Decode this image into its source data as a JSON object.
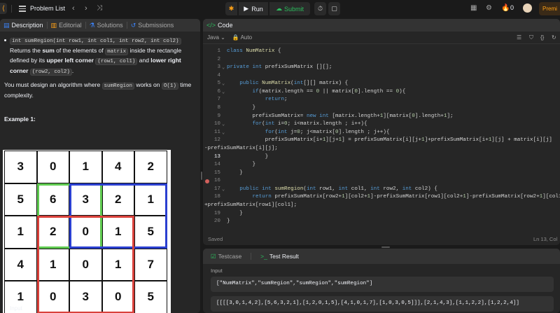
{
  "topbar": {
    "problem_list": "Problem List",
    "run": "Run",
    "submit": "Submit",
    "notif_count": "0",
    "premium": "Premi"
  },
  "left_tabs": [
    "Description",
    "Editorial",
    "Solutions",
    "Submissions"
  ],
  "description": {
    "signature": "int sumRegion(int row1, int col1, int row2, int col2)",
    "l1a": " Returns the ",
    "l1b": "sum",
    "l1c": " of the elements of ",
    "matrix_word": "matrix",
    "l1d": " inside the rectangle defined by its ",
    "upper_left": "upper left corner",
    "ul_coord": "(row1, col1)",
    "and": " and ",
    "lower_right": "lower right corner",
    "lr_coord": "(row2, col2)",
    "period": ".",
    "must_a": "You must design an algorithm where ",
    "sumregion_word": "sumRegion",
    "must_b": " works on ",
    "o1": "O(1)",
    "must_c": " time complexity.",
    "example": "Example 1:"
  },
  "grid": [
    [
      "3",
      "0",
      "1",
      "4",
      "2"
    ],
    [
      "5",
      "6",
      "3",
      "2",
      "1"
    ],
    [
      "1",
      "2",
      "0",
      "1",
      "5"
    ],
    [
      "4",
      "1",
      "0",
      "1",
      "7"
    ],
    [
      "1",
      "0",
      "3",
      "0",
      "5"
    ]
  ],
  "input_peek": "Input",
  "code_tab": "Code",
  "language": "Java",
  "auto": "Auto",
  "code_lines": [
    {
      "n": "1",
      "t": "class NumMatrix {"
    },
    {
      "n": "2",
      "t": ""
    },
    {
      "n": "3",
      "t": "private int prefixSumMatrix [][];"
    },
    {
      "n": "4",
      "t": ""
    },
    {
      "n": "5",
      "t": "    public NumMatrix(int[][] matrix) {"
    },
    {
      "n": "6",
      "t": "        if(matrix.length == 0 || matrix[0].length == 0){"
    },
    {
      "n": "7",
      "t": "            return;"
    },
    {
      "n": "8",
      "t": "        }"
    },
    {
      "n": "9",
      "t": "        prefixSumMatrix= new int [matrix.length+1][matrix[0].length+1];"
    },
    {
      "n": "10",
      "t": "        for(int i=0; i<matrix.length ; i++){"
    },
    {
      "n": "11",
      "t": "            for(int j=0; j<matrix[0].length ; j++){"
    },
    {
      "n": "12",
      "t": "            prefixSumMatrix[i+1][j+1] = prefixSumMatrix[i][j+1]+prefixSumMatrix[i+1][j] + matrix[i][j]"
    },
    {
      "n": "",
      "t": "-prefixSumMatrix[i][j];"
    },
    {
      "n": "13",
      "t": "            }"
    },
    {
      "n": "14",
      "t": "        }"
    },
    {
      "n": "15",
      "t": "    }"
    },
    {
      "n": "16",
      "t": ""
    },
    {
      "n": "17",
      "t": "    public int sumRegion(int row1, int col1, int row2, int col2) {"
    },
    {
      "n": "18",
      "t": "        return prefixSumMatrix[row2+1][col2+1]-prefixSumMatrix[row1][col2+1]-prefixSumMatrix[row2+1][col1]"
    },
    {
      "n": "",
      "t": "+prefixSumMatrix[row1][col1];"
    },
    {
      "n": "19",
      "t": "    }"
    },
    {
      "n": "20",
      "t": "}"
    }
  ],
  "status_left": "Saved",
  "status_right": "Ln 13, Col",
  "test_tabs": [
    "Testcase",
    "Test Result"
  ],
  "input_label": "Input",
  "input_line1": "[\"NumMatrix\",\"sumRegion\",\"sumRegion\",\"sumRegion\"]",
  "input_line2": "[[[[3,0,1,4,2],[5,6,3,2,1],[1,2,0,1,5],[4,1,0,1,7],[1,0,3,0,5]]],[2,1,4,3],[1,1,2,2],[1,2,2,4]]",
  "colors": {
    "green": "#2cbb5d",
    "orange": "#ffa116",
    "rect_red": "#d9413b",
    "rect_green": "#5ec94f",
    "rect_blue": "#2a3fd0"
  }
}
